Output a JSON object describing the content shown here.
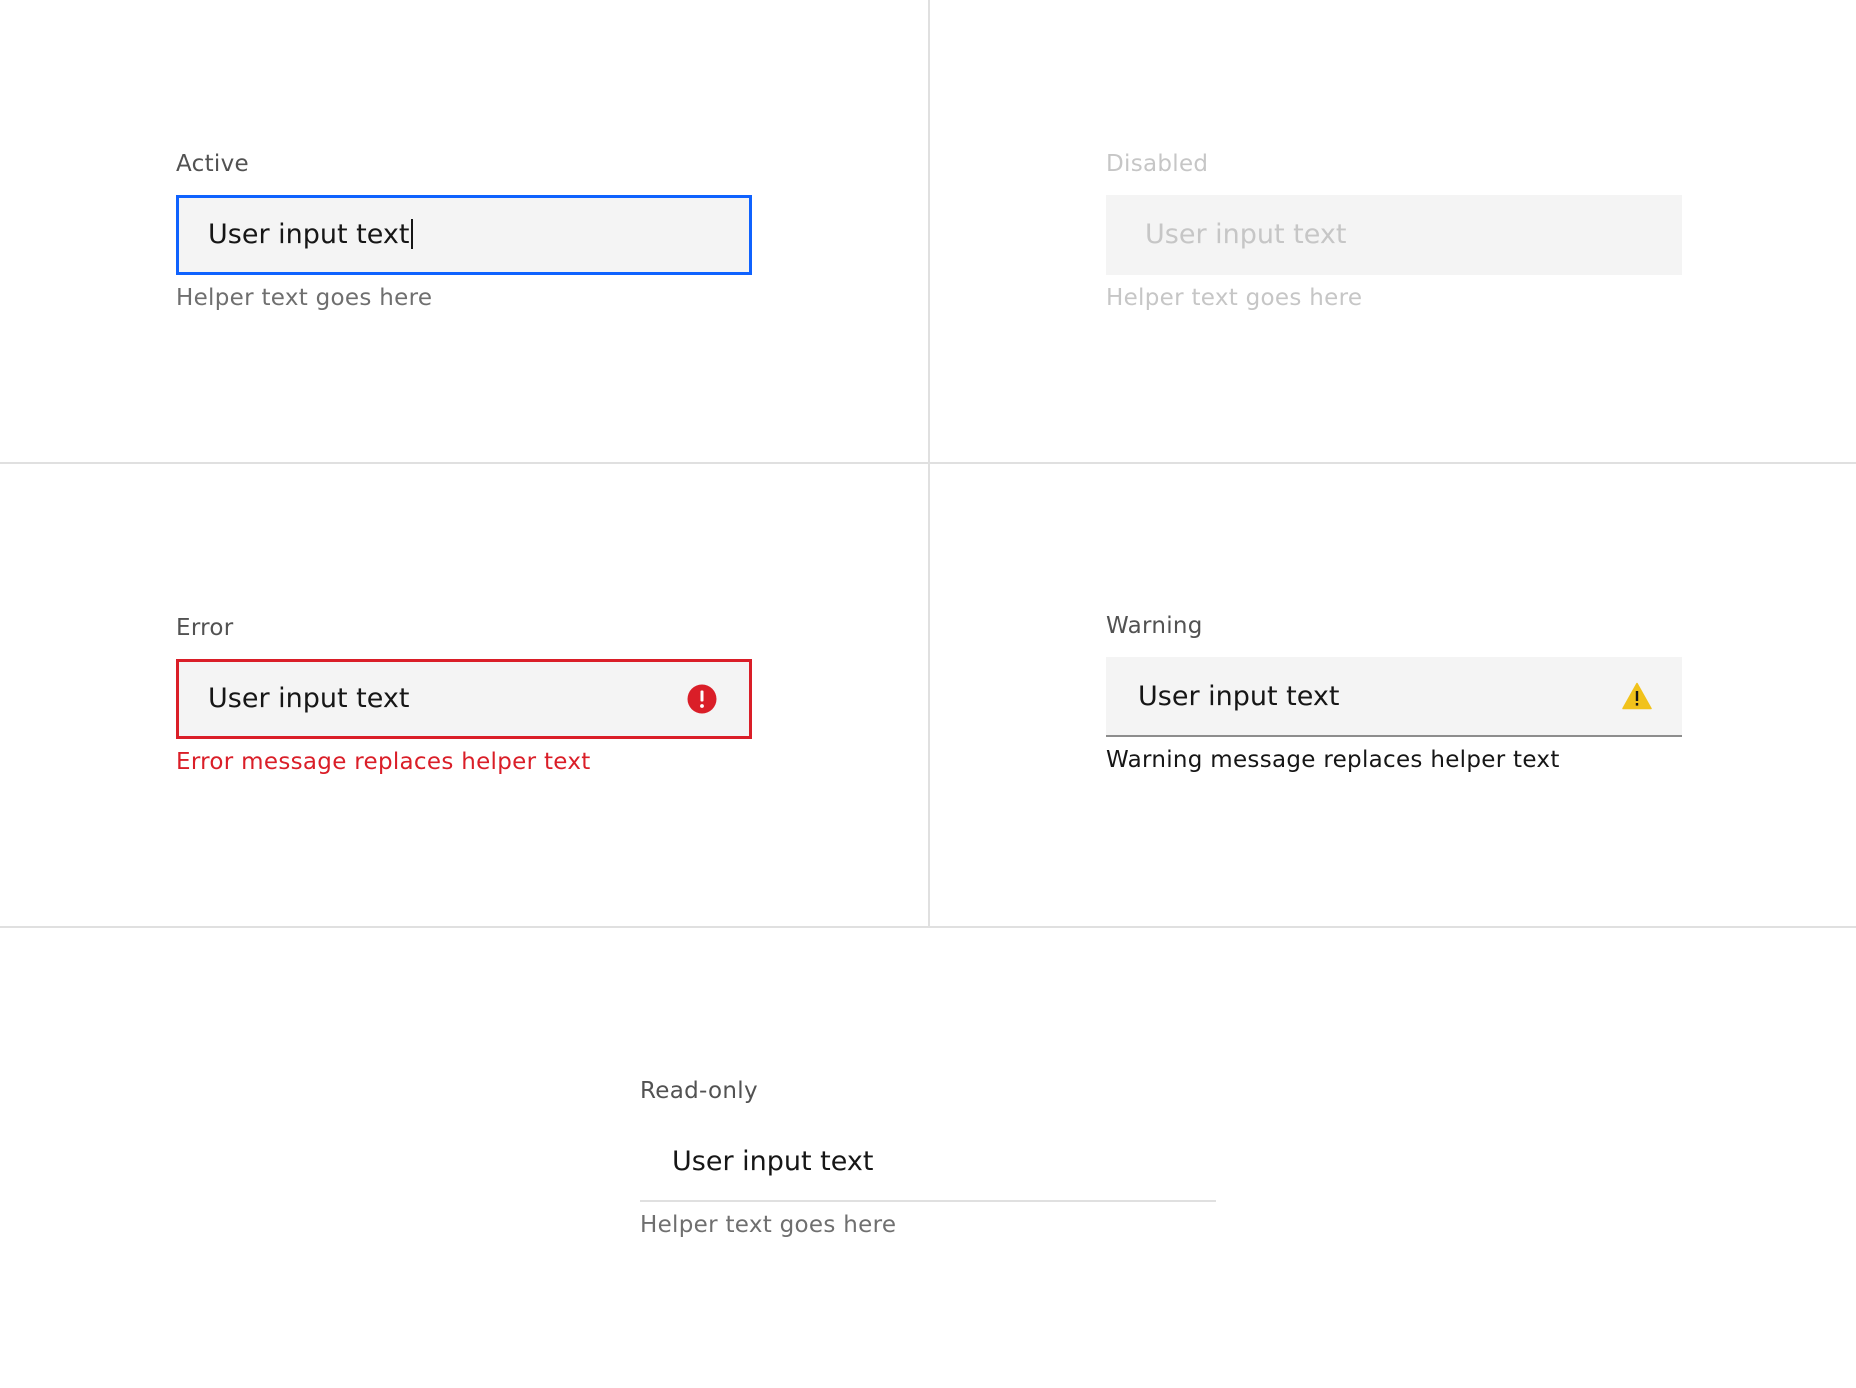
{
  "active": {
    "label": "Active",
    "value": "User input text",
    "helper": "Helper text goes here"
  },
  "disabled": {
    "label": "Disabled",
    "value": "User input text",
    "helper": "Helper text goes here"
  },
  "error": {
    "label": "Error",
    "value": "User input text",
    "message": "Error message replaces helper text",
    "icon": "error-filled-icon"
  },
  "warning": {
    "label": "Warning",
    "value": "User input text",
    "message": "Warning message replaces helper text",
    "icon": "warning-filled-icon"
  },
  "readonly": {
    "label": "Read-only",
    "value": "User input text",
    "helper": "Helper text goes here"
  },
  "colors": {
    "focus": "#0f62fe",
    "error": "#da1e28",
    "warning": "#f1c21b",
    "field_background": "#f4f4f4",
    "divider": "#e0e0e0"
  }
}
